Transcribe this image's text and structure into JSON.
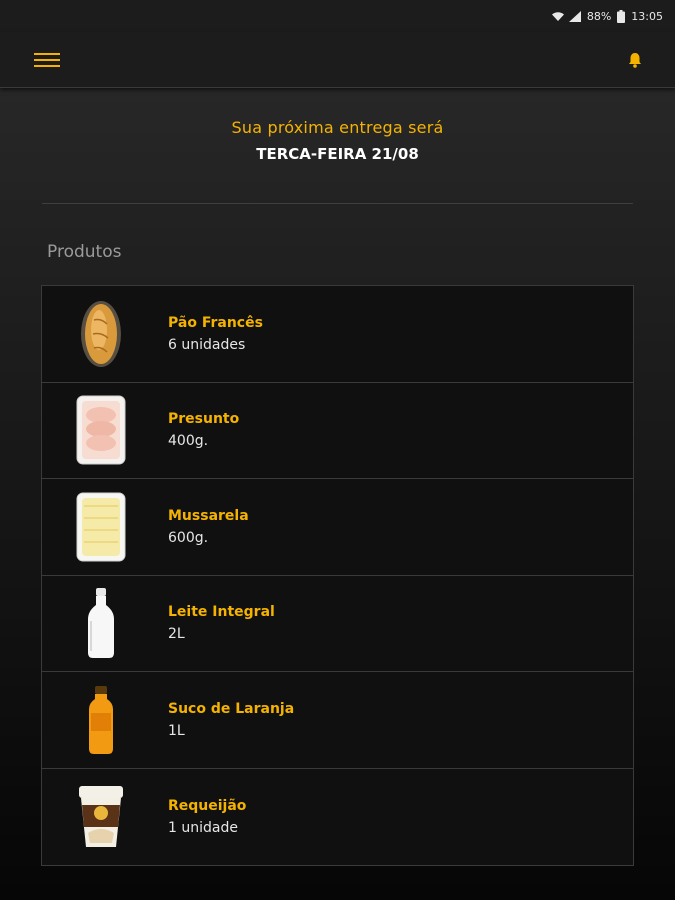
{
  "status_bar": {
    "battery": "88%",
    "time": "13:05"
  },
  "header": {
    "menu_icon": "hamburger-menu-icon",
    "notification_icon": "bell-icon",
    "accent": "#f5b301"
  },
  "delivery": {
    "label": "Sua próxima entrega será",
    "date": "TERCA-FEIRA 21/08"
  },
  "products_section": {
    "title": "Produtos",
    "items": [
      {
        "name": "Pão Francês",
        "quantity": "6 unidades",
        "icon": "bread-roll-icon"
      },
      {
        "name": "Presunto",
        "quantity": "400g.",
        "icon": "ham-package-icon"
      },
      {
        "name": "Mussarela",
        "quantity": "600g.",
        "icon": "cheese-package-icon"
      },
      {
        "name": "Leite Integral",
        "quantity": "2L",
        "icon": "milk-bottle-icon"
      },
      {
        "name": "Suco de Laranja",
        "quantity": "1L",
        "icon": "orange-juice-bottle-icon"
      },
      {
        "name": "Requeijão",
        "quantity": "1 unidade",
        "icon": "cream-cheese-cup-icon"
      }
    ]
  }
}
